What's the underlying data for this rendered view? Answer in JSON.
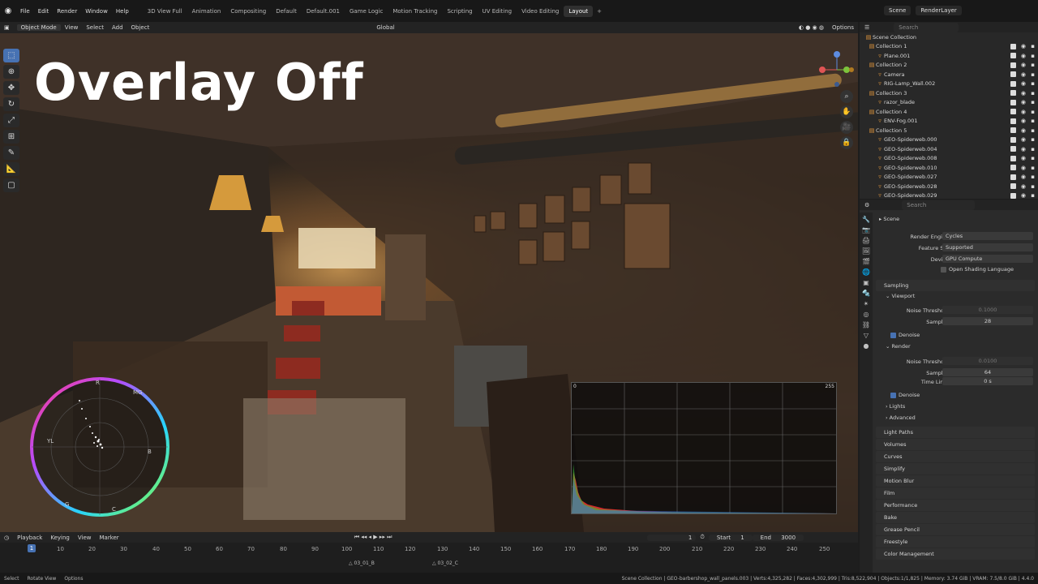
{
  "topbar": {
    "menus": [
      "File",
      "Edit",
      "Render",
      "Window",
      "Help"
    ],
    "workspaces": [
      "3D View Full",
      "Animation",
      "Compositing",
      "Default",
      "Default.001",
      "Game Logic",
      "Motion Tracking",
      "Scripting",
      "UV Editing",
      "Video Editing",
      "Layout"
    ],
    "active_workspace": "Layout",
    "scene": "Scene",
    "view_layer": "RenderLayer"
  },
  "viewport_header": {
    "mode": "Object Mode",
    "menus": [
      "View",
      "Select",
      "Add",
      "Object"
    ],
    "transform": "Global",
    "options": "Options"
  },
  "overlay_text": "Overlay Off",
  "histogram": {
    "min_label": "0",
    "max_label": "255"
  },
  "scope_labels": {
    "r": "R",
    "mg": "MG",
    "b": "B",
    "yl": "YL",
    "g": "G",
    "c": "C"
  },
  "timeline": {
    "menus": [
      "Playback",
      "Keying",
      "View",
      "Marker"
    ],
    "current": "1",
    "start_label": "Start",
    "start": "1",
    "end_label": "End",
    "end": "3000",
    "ticks": [
      "10",
      "20",
      "30",
      "40",
      "50",
      "60",
      "70",
      "80",
      "90",
      "100",
      "110",
      "120",
      "130",
      "140",
      "150",
      "160",
      "170",
      "180",
      "190",
      "200",
      "210",
      "220",
      "230",
      "240",
      "250"
    ],
    "playhead": "1",
    "markers": [
      "03_01_B",
      "03_02_C"
    ]
  },
  "statusbar": {
    "left": [
      "Select",
      "Rotate View",
      "Options"
    ],
    "right": "Scene Collection | GEO-barbershop_wall_panels.003 | Verts:4,325,282 | Faces:4,302,999 | Tris:8,522,904 | Objects:1/1,825 | Memory: 3.74 GiB | VRAM: 7.5/8.0 GiB | 4.4.0"
  },
  "outliner": {
    "search": "Search",
    "title": "Scene Collection",
    "rows": [
      {
        "label": "Collection 1",
        "indent": 1
      },
      {
        "label": "Plane.001",
        "indent": 2
      },
      {
        "label": "Collection 2",
        "indent": 1
      },
      {
        "label": "Camera",
        "indent": 2
      },
      {
        "label": "RIG-Lamp_Wall.002",
        "indent": 2
      },
      {
        "label": "Collection 3",
        "indent": 1
      },
      {
        "label": "razor_blade",
        "indent": 2
      },
      {
        "label": "Collection 4",
        "indent": 1
      },
      {
        "label": "ENV-Fog.001",
        "indent": 2
      },
      {
        "label": "Collection 5",
        "indent": 1
      },
      {
        "label": "GEO-Spiderweb.000",
        "indent": 2
      },
      {
        "label": "GEO-Spiderweb.004",
        "indent": 2
      },
      {
        "label": "GEO-Spiderweb.008",
        "indent": 2
      },
      {
        "label": "GEO-Spiderweb.010",
        "indent": 2
      },
      {
        "label": "GEO-Spiderweb.027",
        "indent": 2
      },
      {
        "label": "GEO-Spiderweb.028",
        "indent": 2
      },
      {
        "label": "GEO-Spiderweb.029",
        "indent": 2
      }
    ]
  },
  "properties": {
    "search": "Search",
    "context": "Scene",
    "render_engine_label": "Render Engine",
    "render_engine": "Cycles",
    "feature_set_label": "Feature Set",
    "feature_set": "Supported",
    "device_label": "Device",
    "device": "GPU Compute",
    "osl": "Open Shading Language",
    "sampling": "Sampling",
    "viewport": "Viewport",
    "noise_threshold_label": "Noise Threshold",
    "vp_noise": "0.1000",
    "samples_label": "Samples",
    "vp_samples": "28",
    "denoise": "Denoise",
    "render": "Render",
    "r_noise": "0.0100",
    "r_samples": "64",
    "time_limit_label": "Time Limit",
    "time_limit": "0 s",
    "lights": "Lights",
    "advanced": "Advanced",
    "sections": [
      "Light Paths",
      "Volumes",
      "Curves",
      "Simplify",
      "Motion Blur",
      "Film",
      "Performance",
      "Bake",
      "Grease Pencil",
      "Freestyle",
      "Color Management"
    ]
  }
}
